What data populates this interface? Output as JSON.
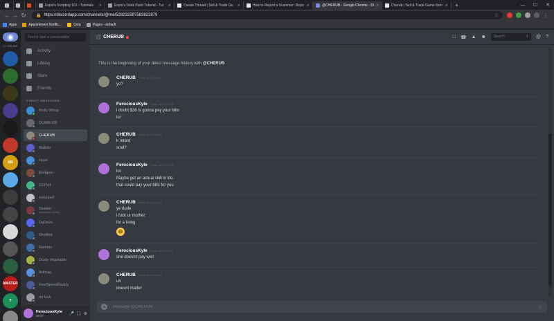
{
  "browser": {
    "tabs": [
      {
        "label": "",
        "icon_color": "#bdc1c6",
        "small": true
      },
      {
        "label": "",
        "icon_color": "#bdc1c6",
        "small": true
      },
      {
        "label": "",
        "icon_color": "#e3491a",
        "small": true
      },
      {
        "label": "Espio's Scripting 101 - Tutorials",
        "icon_color": "#9aa0a6",
        "active": false
      },
      {
        "label": "Espio's Dank Paint Tutorial - Tut",
        "icon_color": "#9aa0a6",
        "active": false
      },
      {
        "label": "Create Thread | Sell & Trade Gu",
        "icon_color": "#e8eaed",
        "active": false
      },
      {
        "label": "How to Report a Scammer: Repo",
        "icon_color": "#e8eaed",
        "active": false
      },
      {
        "label": "@CHERUB - Google Chrome - Di",
        "icon_color": "#7289da",
        "active": true
      },
      {
        "label": "Cherub | Sell & Trade Game Item",
        "icon_color": "#e8eaed",
        "active": false
      }
    ],
    "new_tab": "+",
    "url": "https://discordapp.com/channels/@me/528232597583822879",
    "bookmarks": [
      {
        "label": "Apps",
        "icon_color": "#4285f4"
      },
      {
        "label": "Appointment Notific...",
        "icon_color": "#e8a000"
      },
      {
        "label": "Corp",
        "icon_color": "#fbbc05"
      },
      {
        "label": "Pages - default",
        "icon_color": "#9aa0a6"
      }
    ]
  },
  "guilds": {
    "online_count": "17 ONLINE",
    "items": [
      {
        "color": "#1f5ba6",
        "label": ""
      },
      {
        "color": "#2e6b2e",
        "label": ""
      },
      {
        "color": "#3a3a1a",
        "label": ""
      },
      {
        "color": "#4a3b8c",
        "label": ""
      },
      {
        "color": "#1a1a1a",
        "label": ""
      },
      {
        "color": "#c0392b",
        "label": ""
      },
      {
        "color": "#d4a017",
        "label": "RB"
      },
      {
        "color": "#5aa9e6",
        "label": ""
      },
      {
        "color": "#3d3d3d",
        "label": ""
      },
      {
        "color": "#444444",
        "label": ""
      },
      {
        "color": "#d9d9d9",
        "label": ""
      },
      {
        "color": "#555555",
        "label": ""
      },
      {
        "color": "#2c5e3f",
        "label": ""
      },
      {
        "color": "#b71c1c",
        "label": "MASTER"
      },
      {
        "color": "#1b8e5a",
        "label": "T"
      },
      {
        "color": "#888888",
        "label": ""
      }
    ]
  },
  "channels": {
    "find_placeholder": "Find or start a conversation",
    "nav": [
      {
        "label": "Activity"
      },
      {
        "label": "Library"
      },
      {
        "label": "Store"
      },
      {
        "label": "Friends"
      }
    ],
    "dm_header": "DIRECT MESSAGES",
    "dms": [
      {
        "name": "Molly Whop",
        "color": "#3b8cd1",
        "status": "#43b581"
      },
      {
        "name": "DUMBLEB",
        "color": "#6a6a6a",
        "status": "#747f8d"
      },
      {
        "name": "CHERUB",
        "color": "#8a8a7a",
        "status": "#f04747",
        "active": true
      },
      {
        "name": "Malloki",
        "color": "#5b5fc7",
        "status": "#747f8d"
      },
      {
        "name": "Hype",
        "color": "#4a90d9",
        "status": "#747f8d"
      },
      {
        "name": "jkodgren",
        "color": "#7a4b3a",
        "status": "#747f8d"
      },
      {
        "name": "1237rd",
        "color": "#43b581",
        "status": "#747f8d"
      },
      {
        "name": "Ironpaw2",
        "color": "#c0c0c0",
        "status": "#747f8d"
      },
      {
        "name": "Sinister",
        "color": "#7a3b3b",
        "status": "#747f8d",
        "sub": "Listening to Spotify"
      },
      {
        "name": "DaDeva",
        "color": "#5865f2",
        "status": "#747f8d"
      },
      {
        "name": "Ohoffed",
        "color": "#2f5a8a",
        "status": "#747f8d"
      },
      {
        "name": "Remmo",
        "color": "#3a6ea5",
        "status": "#747f8d"
      },
      {
        "name": "Dusty Vegetable",
        "color": "#a8b04a",
        "status": "#747f8d"
      },
      {
        "name": "Arthrag",
        "color": "#5a8fd9",
        "status": "#747f8d"
      },
      {
        "name": "FourSpeedDaddy",
        "color": "#4a5a9a",
        "status": "#747f8d"
      },
      {
        "name": "mr luck",
        "color": "#9a9a9a",
        "status": "#747f8d"
      }
    ],
    "user": {
      "name": "FerociousKyle",
      "tag": "#6757"
    }
  },
  "chat": {
    "title": "CHERUB",
    "search_placeholder": "Search",
    "intro_prefix": "This is the beginning of your direct message history with ",
    "intro_name": "@CHERUB",
    "intro_suffix": ".",
    "composer_placeholder": "Message @CHERUB",
    "groups": [
      {
        "author": "CHERUB",
        "time": "Today at 10:25 AM",
        "avatar": "#8a8a7a",
        "lines": [
          "yo?"
        ]
      },
      {
        "author": "FerociousKyle",
        "time": "Today at 10:26 AM",
        "avatar": "#b072d8",
        "lines": [
          "i doubt $36 is gonna pay your bills",
          "lol"
        ]
      },
      {
        "author": "CHERUB",
        "time": "Today at 10:26 AM",
        "avatar": "#8a8a7a",
        "lines": [
          "k retard",
          "smd?"
        ]
      },
      {
        "author": "FerociousKyle",
        "time": "Today at 10:26 AM",
        "avatar": "#b072d8",
        "lines": [
          "lol.",
          "Maybe get an actual skill in life.",
          "that could pay your bills for you"
        ]
      },
      {
        "author": "CHERUB",
        "time": "Today at 10:31 AM",
        "avatar": "#8a8a7a",
        "lines": [
          "ye dude",
          "i fuck ur mother",
          "for a living"
        ],
        "emoji": "😂"
      },
      {
        "author": "FerociousKyle",
        "time": "Today at 10:32 AM",
        "avatar": "#b072d8",
        "lines": [
          "she doesn't pay well"
        ]
      },
      {
        "author": "CHERUB",
        "time": "Today at 10:33 AM",
        "avatar": "#8a8a7a",
        "lines": [
          "uh",
          "doesnt matter"
        ]
      }
    ]
  }
}
